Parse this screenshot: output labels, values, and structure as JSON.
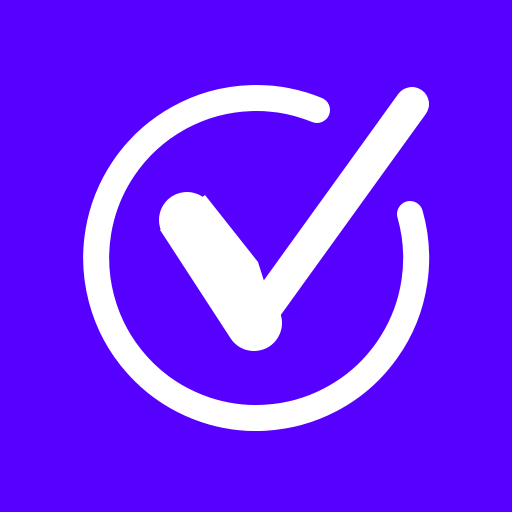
{
  "icon": {
    "name": "checkmark-circle-icon",
    "background_color": "#5600ff",
    "foreground_color": "#ffffff"
  }
}
